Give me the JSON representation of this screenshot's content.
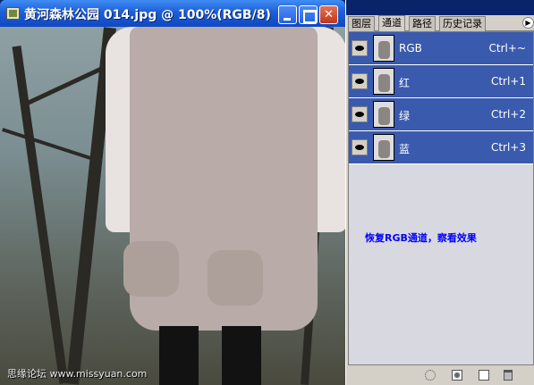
{
  "window": {
    "title": "黄河森林公园 014.jpg @ 100%(RGB/8)"
  },
  "watermark": "思缘论坛 www.missyuan.com",
  "panel": {
    "tabs": [
      "图层",
      "通道",
      "路径",
      "历史记录"
    ],
    "active_tab": "通道",
    "channels": [
      {
        "name": "RGB",
        "shortcut": "Ctrl+~"
      },
      {
        "name": "红",
        "shortcut": "Ctrl+1"
      },
      {
        "name": "绿",
        "shortcut": "Ctrl+2"
      },
      {
        "name": "蓝",
        "shortcut": "Ctrl+3"
      }
    ],
    "note": "恢复RGB通道，察看效果"
  },
  "colors": {
    "title_bar": "#1e5fd7",
    "channel_selected": "#3a5aad",
    "note_text": "#0000ff"
  },
  "icons": [
    "minimize-icon",
    "maximize-icon",
    "close-icon",
    "eye-icon",
    "panel-menu-icon",
    "load-selection-icon",
    "save-selection-icon",
    "new-channel-icon",
    "delete-channel-icon"
  ]
}
